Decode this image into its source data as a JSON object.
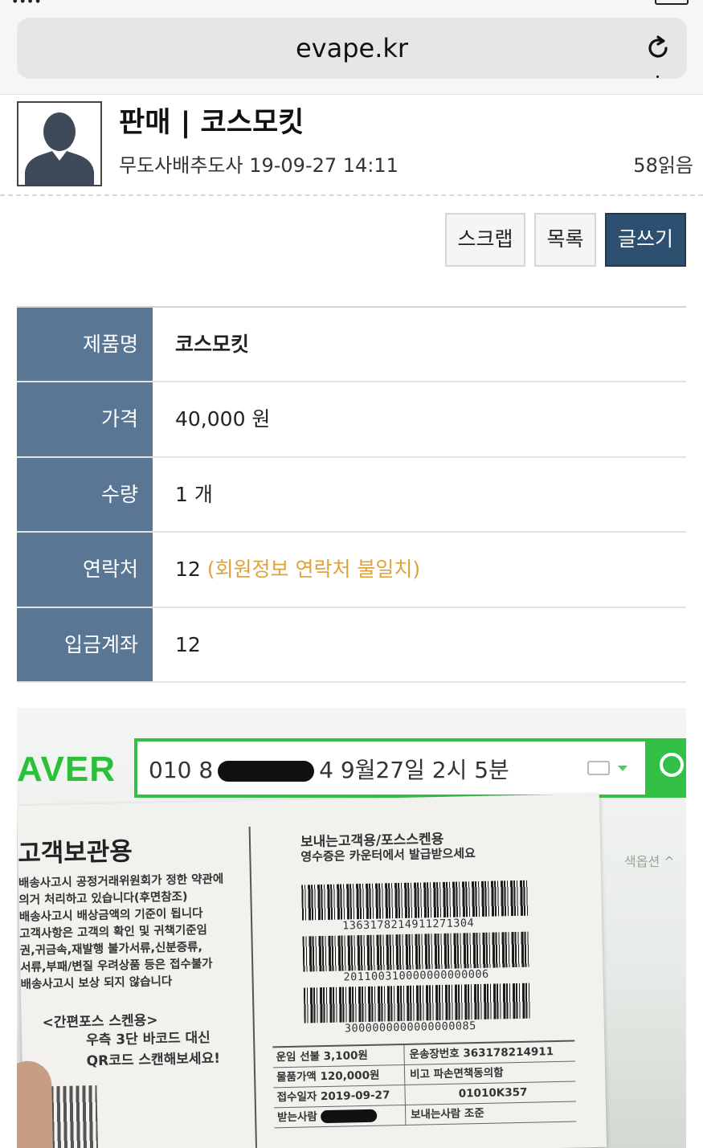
{
  "browser": {
    "url": "evape.kr"
  },
  "post": {
    "title": "판매 | 코스모킷",
    "author": "무도사배추도사",
    "datetime": "19-09-27 14:11",
    "views": "58읽음"
  },
  "actions": {
    "scrap": "스크랩",
    "list": "목록",
    "write": "글쓰기"
  },
  "info": {
    "rows": [
      {
        "label": "제품명",
        "value": "코스모킷"
      },
      {
        "label": "가격",
        "value": "40,000 원"
      },
      {
        "label": "수량",
        "value": "1 개"
      },
      {
        "label": "연락처",
        "value": "12",
        "note": "(회원정보 연락처 불일치)"
      },
      {
        "label": "입금계좌",
        "value": "12"
      }
    ]
  },
  "photo": {
    "logo": "AVER",
    "search_prefix": "010 8",
    "search_suffix": "4 9월27일 2시 5분",
    "side_text": "색옵션 ^",
    "receipt_left": {
      "heading": "고객보관용",
      "lines": [
        "배송사고시 공정거래위원회가 정한 약관에",
        "의거 처리하고 있습니다(후면참조)",
        "배송사고시 배상금액의 기준이 됩니다",
        "고객사항은 고객의 확인 및 귀책기준임",
        "권,귀금속,재발행 불가서류,신분증류,",
        "서류,부패/변질 우려상품 등은 접수불가",
        "배송사고시 보상 되지 않습니다"
      ],
      "scan_title": "<간편포스 스켄용>",
      "scan_line1": "우측 3단 바코드 대신",
      "scan_line2": "QR코드 스캔해보세요!"
    },
    "receipt_right": {
      "heading": "보내는고객용/포스스켄용",
      "subheading": "영수증은 카운터에서 발급받으세요",
      "barcode1": "1363178214911271304",
      "barcode2": "201100310000000000006",
      "barcode3": "3000000000000000085",
      "grid": [
        {
          "left": "운임 선불 3,100원",
          "right": "운송장번호 363178214911"
        },
        {
          "left": "물품가액 120,000원",
          "right": "비고 파손면책동의함"
        },
        {
          "left": "접수일자 2019-09-27",
          "right": "01010K357"
        },
        {
          "left": "받는사람",
          "right": "보내는사람 조준"
        }
      ]
    }
  }
}
